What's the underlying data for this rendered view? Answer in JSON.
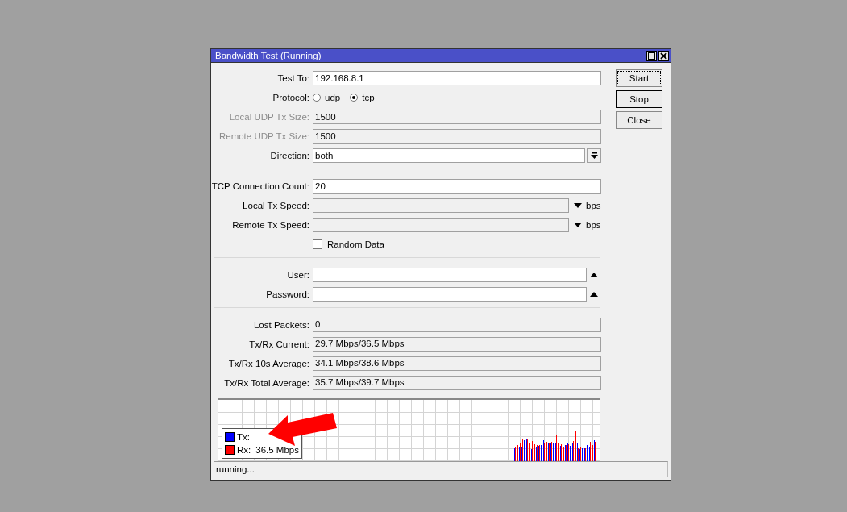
{
  "window": {
    "title": "Bandwidth Test (Running)"
  },
  "form": [
    {
      "kind": "text",
      "label": "Test To:",
      "value": "192.168.8.1",
      "disabled": false
    },
    {
      "kind": "radio",
      "label": "Protocol:",
      "options": [
        {
          "label": "udp",
          "selected": false
        },
        {
          "label": "tcp",
          "selected": true
        }
      ]
    },
    {
      "kind": "text",
      "label": "Local UDP Tx Size:",
      "value": "1500",
      "disabled": true
    },
    {
      "kind": "text",
      "label": "Remote UDP Tx Size:",
      "value": "1500",
      "disabled": true
    },
    {
      "kind": "dropdown",
      "label": "Direction:",
      "value": "both"
    },
    {
      "kind": "separator"
    },
    {
      "kind": "text",
      "label": "TCP Connection Count:",
      "value": "20",
      "disabled": false
    },
    {
      "kind": "speed",
      "label": "Local Tx Speed:",
      "unit": "bps"
    },
    {
      "kind": "speed",
      "label": "Remote Tx Speed:",
      "unit": "bps"
    },
    {
      "kind": "checkbox",
      "label": "Random Data",
      "checked": false
    },
    {
      "kind": "separator"
    },
    {
      "kind": "secret",
      "label": "User:"
    },
    {
      "kind": "secret",
      "label": "Password:"
    },
    {
      "kind": "separator"
    },
    {
      "kind": "readout",
      "label": "Lost Packets:",
      "value": "0"
    },
    {
      "kind": "readout",
      "label": "Tx/Rx Current:",
      "value": "29.7 Mbps/36.5 Mbps"
    },
    {
      "kind": "readout",
      "label": "Tx/Rx 10s Average:",
      "value": "34.1 Mbps/38.6 Mbps"
    },
    {
      "kind": "readout",
      "label": "Tx/Rx Total Average:",
      "value": "35.7 Mbps/39.7 Mbps"
    }
  ],
  "buttons": [
    {
      "label": "Start",
      "focused": true,
      "default": false
    },
    {
      "label": "Stop",
      "focused": false,
      "default": true
    },
    {
      "label": "Close",
      "focused": false,
      "default": false
    }
  ],
  "graph": {
    "legend": [
      {
        "label": "Tx:",
        "color": "#0000ff"
      },
      {
        "label": "Rx:",
        "value": "36.5 Mbps",
        "color": "#ff0000"
      }
    ]
  },
  "status_bar": "running..."
}
